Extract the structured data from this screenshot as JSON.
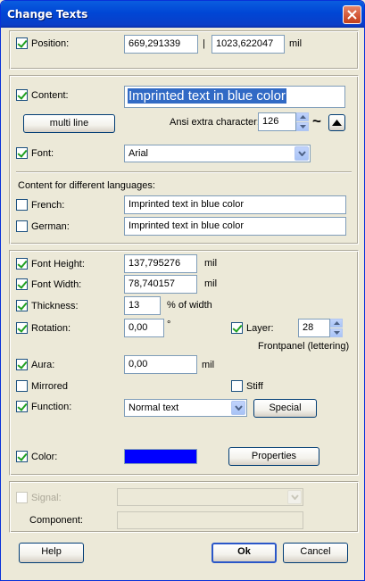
{
  "window": {
    "title": "Change Texts"
  },
  "position": {
    "label": "Position:",
    "checked": true,
    "x_value": "669,291339",
    "separator": "|",
    "y_value": "1023,622047",
    "unit": "mil"
  },
  "content": {
    "label": "Content:",
    "checked": true,
    "value": "Imprinted text in blue color",
    "multiline_button": "multi line",
    "ansi_label": "Ansi extra character:",
    "ansi_value": "126",
    "ansi_char": "~"
  },
  "font": {
    "label": "Font:",
    "checked": true,
    "value": "Arial"
  },
  "languages": {
    "heading": "Content for different languages:",
    "items": [
      {
        "label": "French:",
        "checked": false,
        "value": "Imprinted text in blue color"
      },
      {
        "label": "German:",
        "checked": false,
        "value": "Imprinted text in blue color"
      }
    ]
  },
  "props": {
    "font_height": {
      "label": "Font Height:",
      "checked": true,
      "value": "137,795276",
      "unit": "mil"
    },
    "font_width": {
      "label": "Font Width:",
      "checked": true,
      "value": "78,740157",
      "unit": "mil"
    },
    "thickness": {
      "label": "Thickness:",
      "checked": true,
      "value": "13",
      "unit": "% of width"
    },
    "rotation": {
      "label": "Rotation:",
      "checked": true,
      "value": "0,00",
      "unit": "°"
    },
    "layer": {
      "label": "Layer:",
      "checked": true,
      "value": "28",
      "caption": "Frontpanel (lettering)"
    },
    "aura": {
      "label": "Aura:",
      "checked": true,
      "value": "0,00",
      "unit": "mil"
    },
    "mirrored": {
      "label": "Mirrored",
      "checked": false
    },
    "stiff": {
      "label": "Stiff",
      "checked": false
    },
    "function": {
      "label": "Function:",
      "checked": true,
      "value": "Normal text",
      "special_button": "Special"
    },
    "color": {
      "label": "Color:",
      "checked": true,
      "swatch": "#0000ff",
      "properties_button": "Properties"
    }
  },
  "signal": {
    "label": "Signal:",
    "checked": false,
    "enabled": false,
    "component_label": "Component:"
  },
  "buttons": {
    "help": "Help",
    "ok": "Ok",
    "cancel": "Cancel"
  }
}
